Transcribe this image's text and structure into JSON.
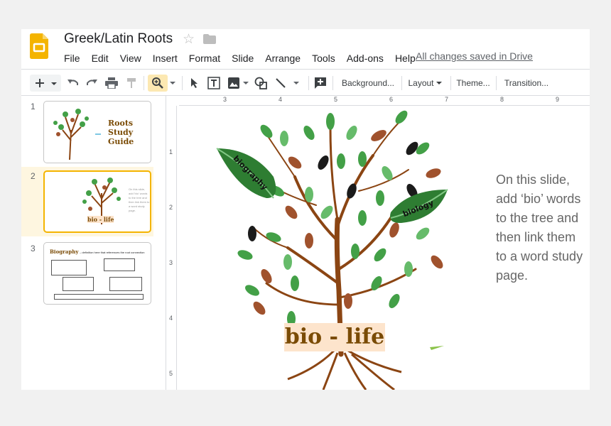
{
  "header": {
    "doc_title": "Greek/Latin Roots",
    "saved_status": "All changes saved in Drive"
  },
  "menu": [
    "File",
    "Edit",
    "View",
    "Insert",
    "Format",
    "Slide",
    "Arrange",
    "Tools",
    "Add-ons",
    "Help"
  ],
  "toolbar": {
    "background": "Background...",
    "layout": "Layout",
    "theme": "Theme...",
    "transition": "Transition..."
  },
  "ruler": {
    "horizontal": [
      "3",
      "4",
      "5",
      "6",
      "7",
      "8",
      "9"
    ],
    "vertical": [
      "1",
      "2",
      "3",
      "4",
      "5"
    ]
  },
  "slides": [
    {
      "number": "1",
      "title": "Roots Study Guide"
    },
    {
      "number": "2",
      "title": "bio - life",
      "note": "On this slide, add 'bio' words to the tree and then link them to a word study page."
    },
    {
      "number": "3",
      "title": "Biography",
      "subtitle": "– definition here that references the root connection"
    }
  ],
  "current_slide": {
    "word_label": "bio - life",
    "leaf_left": "biography",
    "leaf_right": "biology",
    "side_text": "On this slide, add ‘bio’ words to the tree and then link them to a word study page."
  },
  "colors": {
    "logo_yellow": "#f4b400",
    "active_border": "#f4b400",
    "label_brown": "#7a4b05",
    "label_bg": "#fde4cc"
  }
}
